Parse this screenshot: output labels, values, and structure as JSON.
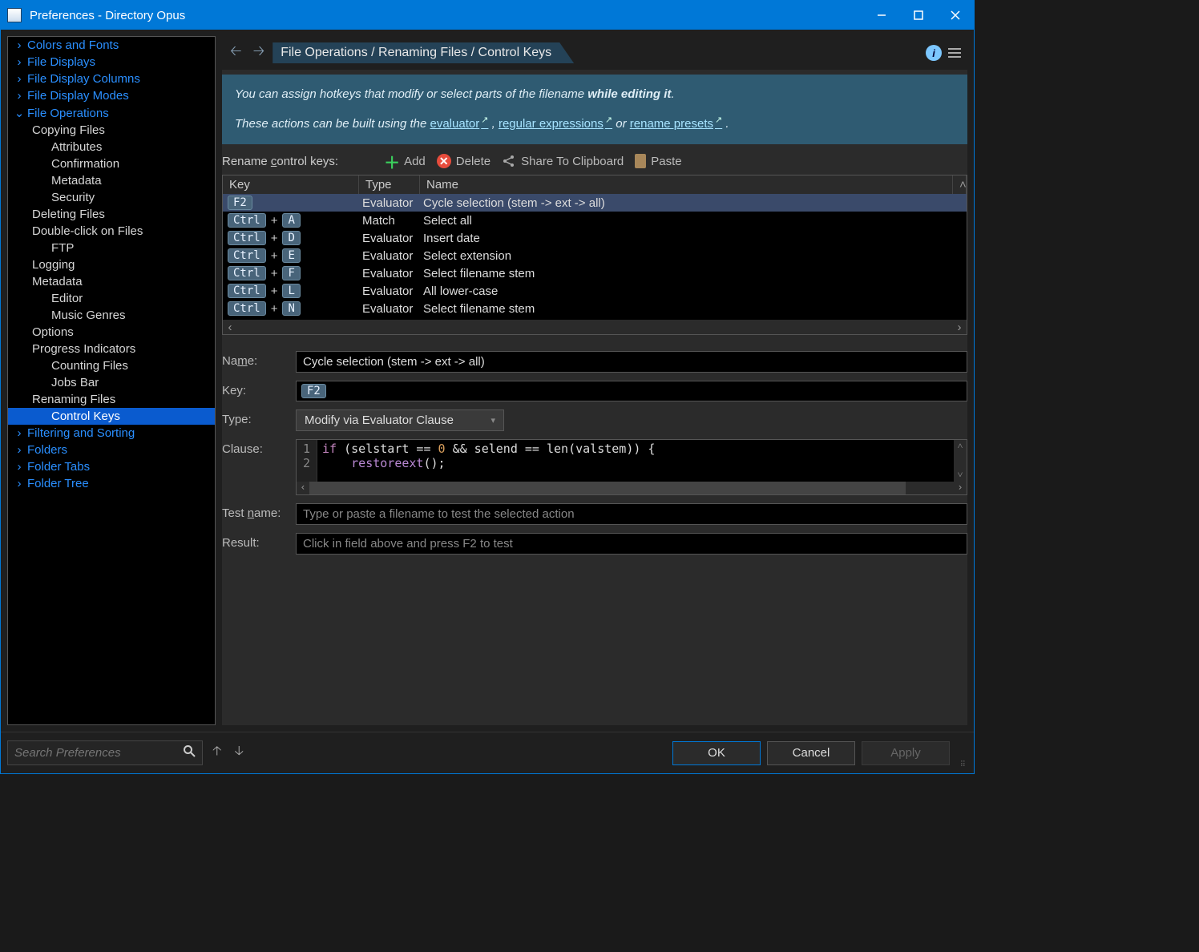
{
  "window_title": "Preferences - Directory Opus",
  "sidebar": {
    "items": [
      {
        "label": "Colors and Fonts",
        "type": "cat",
        "twisty": "›"
      },
      {
        "label": "File Displays",
        "type": "cat",
        "twisty": "›"
      },
      {
        "label": "File Display Columns",
        "type": "cat",
        "twisty": "›"
      },
      {
        "label": "File Display Modes",
        "type": "cat",
        "twisty": "›"
      },
      {
        "label": "File Operations",
        "type": "cat",
        "twisty": "⌄"
      },
      {
        "label": "Copying Files",
        "type": "sub"
      },
      {
        "label": "Attributes",
        "type": "sub2"
      },
      {
        "label": "Confirmation",
        "type": "sub2"
      },
      {
        "label": "Metadata",
        "type": "sub2"
      },
      {
        "label": "Security",
        "type": "sub2"
      },
      {
        "label": "Deleting Files",
        "type": "sub"
      },
      {
        "label": "Double-click on Files",
        "type": "sub"
      },
      {
        "label": "FTP",
        "type": "sub2"
      },
      {
        "label": "Logging",
        "type": "sub"
      },
      {
        "label": "Metadata",
        "type": "sub"
      },
      {
        "label": "Editor",
        "type": "sub2"
      },
      {
        "label": "Music Genres",
        "type": "sub2"
      },
      {
        "label": "Options",
        "type": "sub"
      },
      {
        "label": "Progress Indicators",
        "type": "sub"
      },
      {
        "label": "Counting Files",
        "type": "sub2"
      },
      {
        "label": "Jobs Bar",
        "type": "sub2"
      },
      {
        "label": "Renaming Files",
        "type": "sub"
      },
      {
        "label": "Control Keys",
        "type": "sub2",
        "selected": true
      },
      {
        "label": "Filtering and Sorting",
        "type": "cat",
        "twisty": "›"
      },
      {
        "label": "Folders",
        "type": "cat",
        "twisty": "›"
      },
      {
        "label": "Folder Tabs",
        "type": "cat",
        "twisty": "›"
      },
      {
        "label": "Folder Tree",
        "type": "cat",
        "twisty": "›"
      }
    ]
  },
  "breadcrumb": {
    "part1": "File Operations",
    "part2": "Renaming Files",
    "part3": "Control Keys"
  },
  "intro": {
    "line1a": "You can assign hotkeys that modify or select parts of the filename ",
    "line1b": "while editing it",
    "line2a": "These actions can be built using the ",
    "link1": "evaluator",
    "sep1": ", ",
    "link2": "regular expressions",
    "sep2": " or ",
    "link3": "rename presets",
    "tail": "."
  },
  "toolbar": {
    "title_pre": "Rename ",
    "title_u": "c",
    "title_post": "ontrol keys:",
    "add": "Add",
    "delete": "Delete",
    "share": "Share To Clipboard",
    "paste": "Paste"
  },
  "table": {
    "h_key": "Key",
    "h_type": "Type",
    "h_name": "Name",
    "rows": [
      {
        "keys": [
          "F2"
        ],
        "type": "Evaluator",
        "name": "Cycle selection (stem -> ext -> all)",
        "selected": true
      },
      {
        "keys": [
          "Ctrl",
          "A"
        ],
        "type": "Match",
        "name": "Select all"
      },
      {
        "keys": [
          "Ctrl",
          "D"
        ],
        "type": "Evaluator",
        "name": "Insert date"
      },
      {
        "keys": [
          "Ctrl",
          "E"
        ],
        "type": "Evaluator",
        "name": "Select extension"
      },
      {
        "keys": [
          "Ctrl",
          "F"
        ],
        "type": "Evaluator",
        "name": "Select filename stem"
      },
      {
        "keys": [
          "Ctrl",
          "L"
        ],
        "type": "Evaluator",
        "name": "All lower-case"
      },
      {
        "keys": [
          "Ctrl",
          "N"
        ],
        "type": "Evaluator",
        "name": "Select filename stem"
      }
    ]
  },
  "form": {
    "name_label_pre": "Na",
    "name_label_u": "m",
    "name_label_post": "e:",
    "name_value": "Cycle selection (stem -> ext -> all)",
    "key_label": "Key:",
    "key_value": "F2",
    "type_label": "Type:",
    "type_value": "Modify via Evaluator Clause",
    "clause_label": "Clause:",
    "code_line1_a": "if",
    "code_line1_b": " (selstart == ",
    "code_line1_c": "0",
    "code_line1_d": " && selend == len(valstem)) {",
    "code_line2_a": "    restoreext",
    "code_line2_b": "();",
    "testname_label_pre": "Test ",
    "testname_label_u": "n",
    "testname_label_post": "ame:",
    "testname_placeholder": "Type or paste a filename to test the selected action",
    "result_label": "Result:",
    "result_placeholder": "Click in field above and press F2 to test"
  },
  "footer": {
    "search_placeholder": "Search Preferences",
    "ok": "OK",
    "cancel": "Cancel",
    "apply": "Apply"
  }
}
